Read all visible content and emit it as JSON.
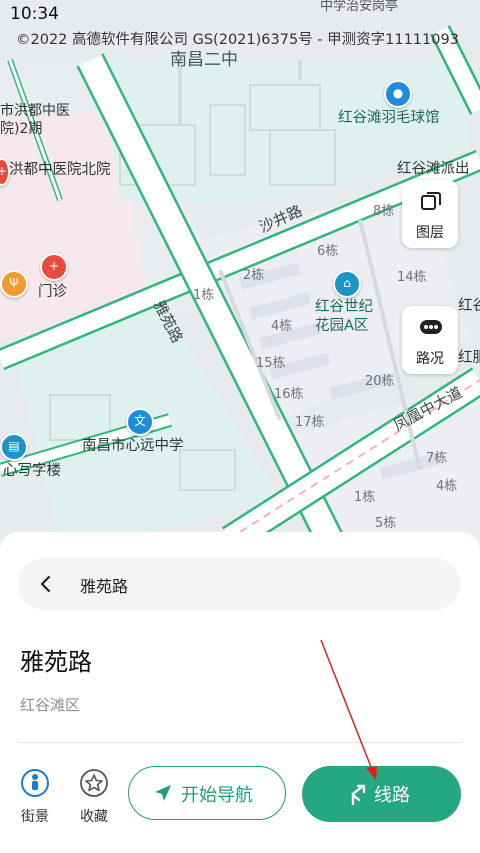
{
  "status_bar": {
    "time": "10:34"
  },
  "map": {
    "copyright": "©2022 高德软件有限公司 GS(2021)6375号 - 甲测资字11111093",
    "road_labels": {
      "shajing": "沙井路",
      "yayuan": "雅苑路",
      "fenghuang": "凤凰中大道"
    },
    "area_labels": {
      "nanchang_2nd": "南昌二中",
      "zhongxue_top": "中学治安岗亭",
      "hongdu_tcm_line1": "市洪都中医",
      "hongdu_tcm_line2": "院)2期",
      "paifang": "红谷滩派出",
      "right_edge": "红谷",
      "right_edge2": "红服务"
    },
    "pois": {
      "badminton": "红谷滩羽毛球馆",
      "hongdu_north": "洪都中医院北院",
      "clinic": "门诊",
      "residence_line1": "红谷世纪",
      "residence_line2": "花园A区",
      "xinyuan_school": "南昌市心远中学",
      "calligraphy": "心写字楼"
    },
    "buildings": {
      "b8": "8栋",
      "b6": "6栋",
      "b2": "2栋",
      "b14": "14栋",
      "b1": "1栋",
      "b4": "4栋",
      "b15": "15栋",
      "b16": "16栋",
      "b17": "17栋",
      "b20": "20栋",
      "b7": "7栋",
      "b1b": "1栋",
      "b4b": "4栋",
      "b5": "5栋"
    },
    "controls": {
      "layers": "图层",
      "traffic": "路况"
    }
  },
  "panel": {
    "search_value": "雅苑路",
    "place_title": "雅苑路",
    "place_district": "红谷滩区",
    "actions": {
      "street_view": "街景",
      "favorite": "收藏"
    },
    "start_nav": "开始导航",
    "route": "线路"
  },
  "colors": {
    "primary_green": "#25a77f",
    "road_outline": "#2db87a",
    "annotation_arrow": "#e02020"
  }
}
